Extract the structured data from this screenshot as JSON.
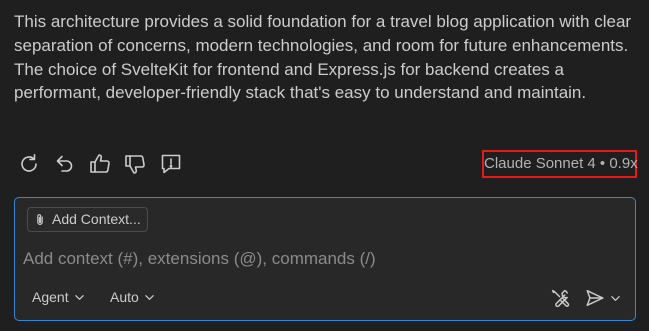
{
  "response": {
    "text": "This architecture provides a solid foundation for a travel blog application with clear separation of concerns, modern technologies, and room for future enhancements. The choice of SvelteKit for frontend and Express.js for backend creates a performant, developer-friendly stack that's easy to understand and maintain."
  },
  "actions": {
    "icons": [
      "retry-icon",
      "undo-icon",
      "thumbs-up-icon",
      "thumbs-down-icon",
      "report-icon"
    ]
  },
  "model": {
    "label": "Claude Sonnet 4 • 0.9x"
  },
  "chat_input": {
    "add_context_label": "Add Context...",
    "placeholder": "Add context (#), extensions (@), commands (/)",
    "value": "",
    "mode_label": "Agent",
    "model_picker_label": "Auto"
  },
  "colors": {
    "background": "#1f1f1f",
    "input_border": "#3a87d1",
    "highlight_box": "#e51a1a",
    "text": "#cccccc",
    "placeholder": "#8b8b8b"
  }
}
